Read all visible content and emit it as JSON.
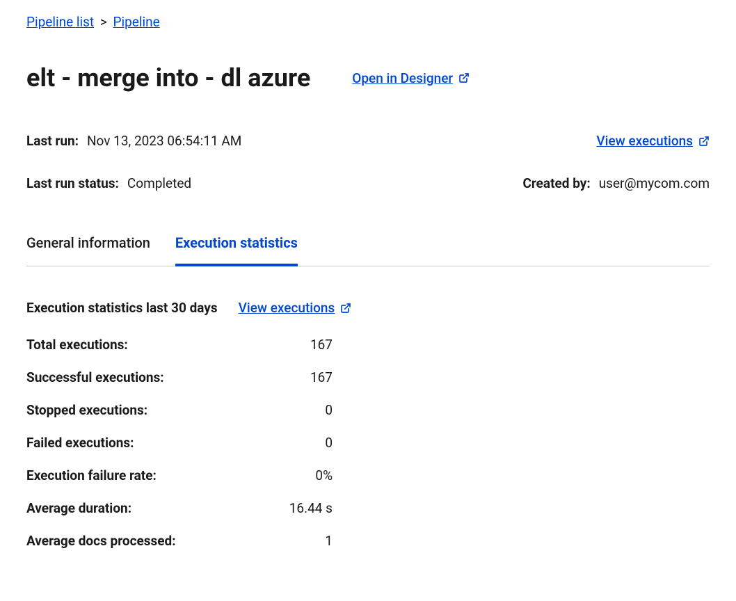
{
  "breadcrumb": {
    "parent": "Pipeline list",
    "separator": ">",
    "current": "Pipeline"
  },
  "page": {
    "title": "elt - merge into - dl azure",
    "open_designer": "Open in Designer"
  },
  "meta": {
    "last_run_label": "Last run:",
    "last_run_value": "Nov 13, 2023 06:54:11 AM",
    "view_executions": "View executions",
    "last_run_status_label": "Last run status:",
    "last_run_status_value": "Completed",
    "created_by_label": "Created by:",
    "created_by_value": "user@mycom.com"
  },
  "tabs": {
    "general": "General information",
    "execution": "Execution statistics"
  },
  "stats": {
    "header": "Execution statistics last 30 days",
    "view_link": "View executions",
    "rows": [
      {
        "label": "Total executions:",
        "value": "167"
      },
      {
        "label": "Successful executions:",
        "value": "167"
      },
      {
        "label": "Stopped executions:",
        "value": "0"
      },
      {
        "label": "Failed executions:",
        "value": "0"
      },
      {
        "label": "Execution failure rate:",
        "value": "0%"
      },
      {
        "label": "Average duration:",
        "value": "16.44 s"
      },
      {
        "label": "Average docs processed:",
        "value": "1"
      }
    ]
  }
}
